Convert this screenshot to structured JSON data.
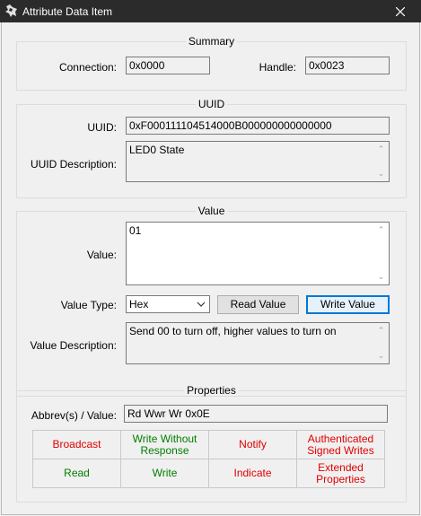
{
  "window": {
    "title": "Attribute Data Item"
  },
  "summary": {
    "legend": "Summary",
    "connection_label": "Connection:",
    "connection_value": "0x0000",
    "handle_label": "Handle:",
    "handle_value": "0x0023"
  },
  "uuid": {
    "legend": "UUID",
    "uuid_label": "UUID:",
    "uuid_value": "0xF000111104514000B000000000000000",
    "desc_label": "UUID Description:",
    "desc_value": "LED0 State"
  },
  "value": {
    "legend": "Value",
    "value_label": "Value:",
    "value_text": "01",
    "type_label": "Value Type:",
    "type_selected": "Hex",
    "read_button": "Read Value",
    "write_button": "Write Value",
    "desc_label": "Value Description:",
    "desc_text": "Send 00 to turn off, higher values to turn on"
  },
  "properties": {
    "legend": "Properties",
    "abbrev_label": "Abbrev(s) / Value:",
    "abbrev_value": "Rd Wwr Wr  0x0E",
    "row1": {
      "broadcast": "Broadcast",
      "write_without_response_1": "Write Without",
      "write_without_response_2": "Response",
      "notify": "Notify",
      "auth_signed_1": "Authenticated",
      "auth_signed_2": "Signed Writes"
    },
    "row2": {
      "read": "Read",
      "write": "Write",
      "indicate": "Indicate",
      "extended_1": "Extended",
      "extended_2": "Properties"
    },
    "colors": {
      "enabled": "#007e00",
      "disabled": "#e00000"
    }
  }
}
